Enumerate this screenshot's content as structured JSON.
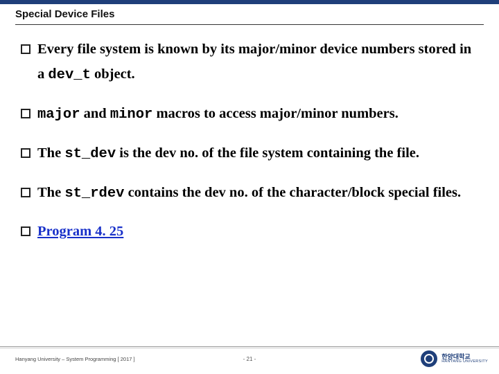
{
  "title": "Special Device Files",
  "bullets": {
    "b1_a": "Every file system is known by its major/minor device numbers stored in a ",
    "b1_code": "dev_t",
    "b1_b": " object.",
    "b2_code1": "major",
    "b2_mid": " and ",
    "b2_code2": "minor",
    "b2_tail": " macros  to access major/minor numbers.",
    "b3_a": "The  ",
    "b3_code": "st_dev",
    "b3_b": "  is the dev no. of the file system containing the file.",
    "b4_a": "The ",
    "b4_code": "st_rdev",
    "b4_b": "  contains the dev no. of the character/block special files.",
    "b5_link": "Program 4. 25"
  },
  "footer": {
    "left": "Hanyang University – System Programming  [ 2017 ]",
    "center": "- 21 -"
  },
  "logo": {
    "kr": "한양대학교",
    "en": "HANYANG UNIVERSITY"
  }
}
